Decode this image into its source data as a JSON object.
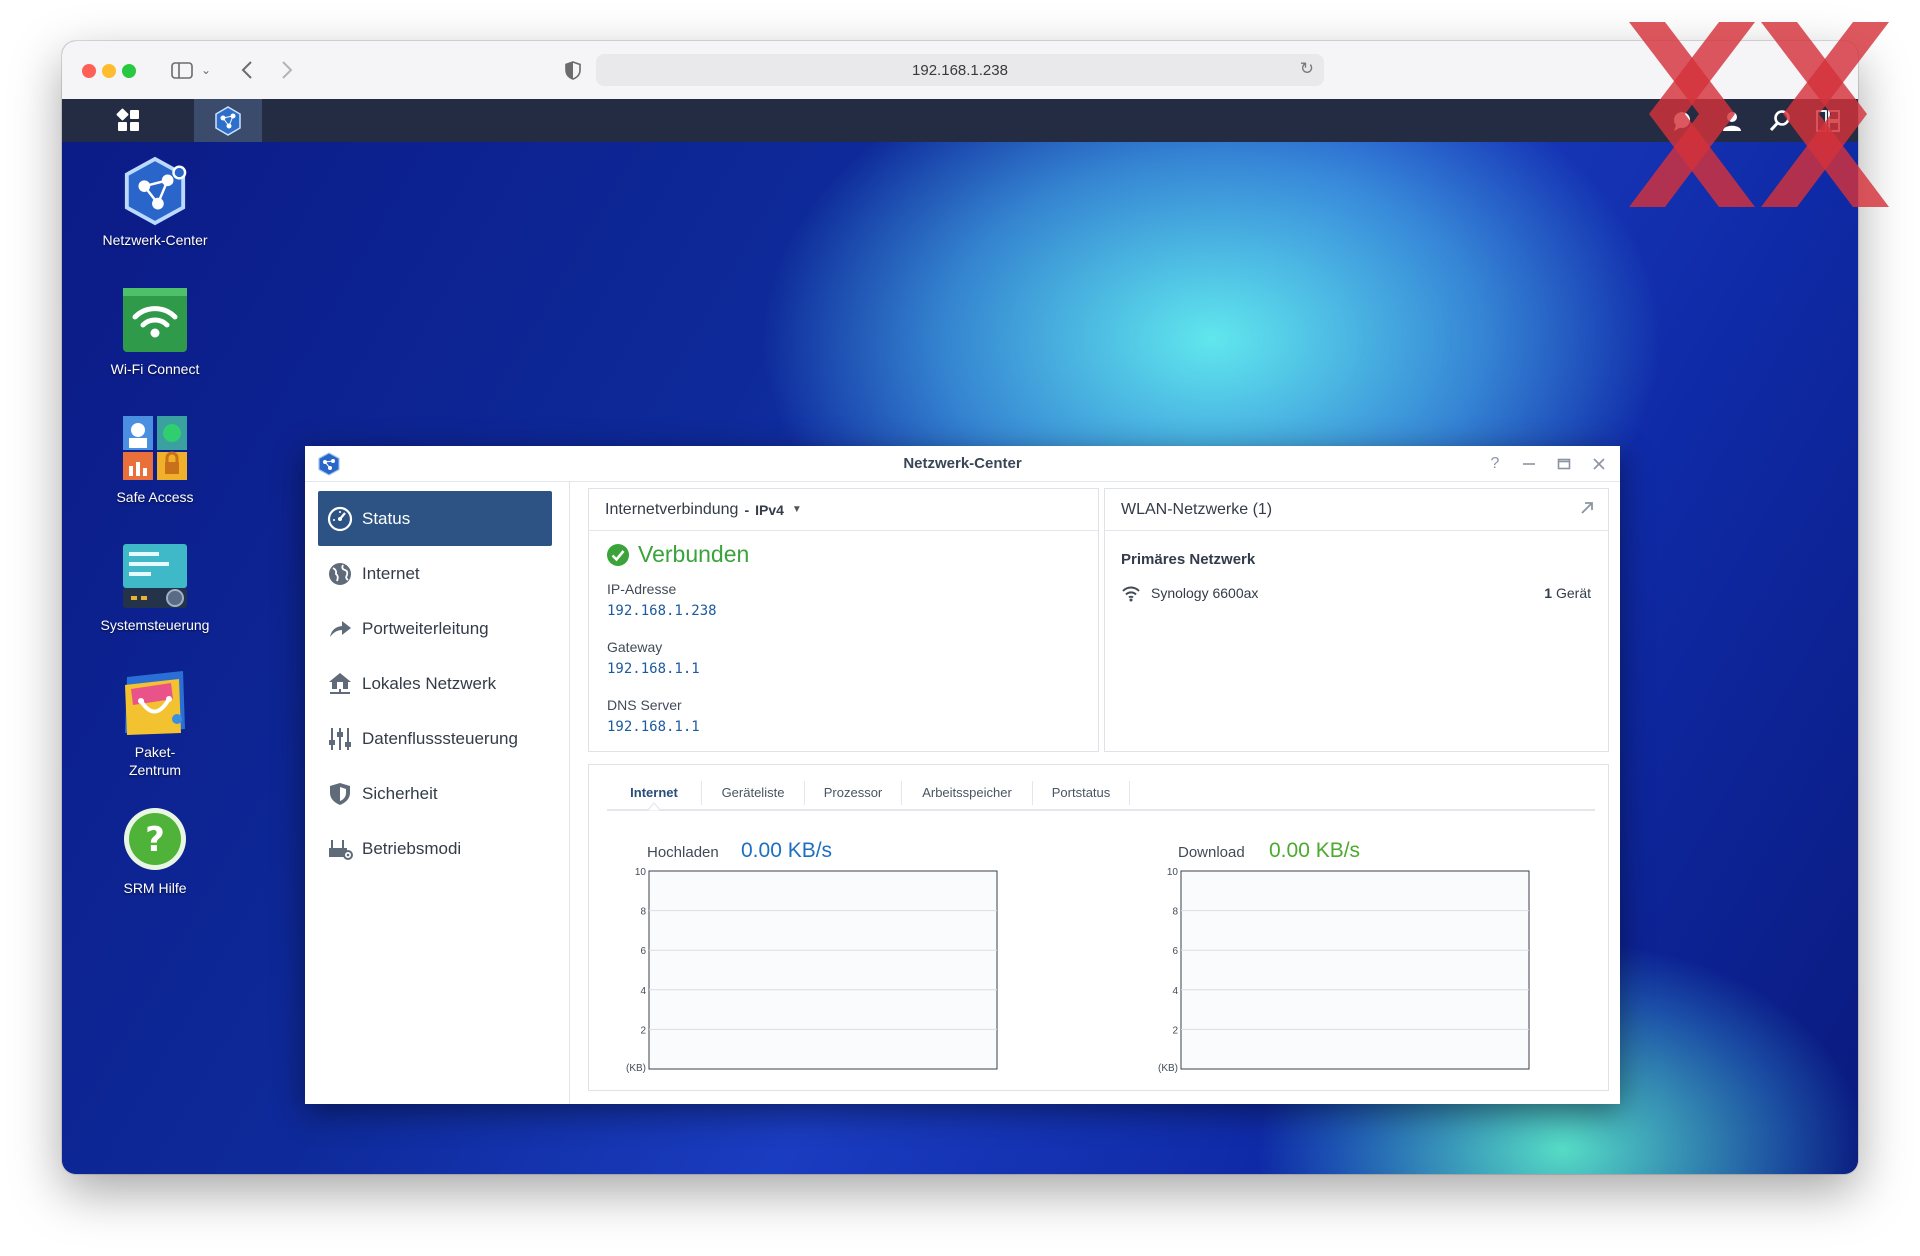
{
  "browser": {
    "address": "192.168.1.238"
  },
  "desktop_icons": [
    {
      "label": "Netzwerk-Center",
      "icon": "network-center-icon"
    },
    {
      "label": "Wi-Fi Connect",
      "icon": "wifi-connect-icon"
    },
    {
      "label": "Safe Access",
      "icon": "safe-access-icon"
    },
    {
      "label": "Systemsteuerung",
      "icon": "control-panel-icon"
    },
    {
      "label": "Paket-\nZentrum",
      "icon": "package-center-icon"
    },
    {
      "label": "SRM Hilfe",
      "icon": "help-icon"
    }
  ],
  "window": {
    "title": "Netzwerk-Center",
    "controls": [
      "help-icon",
      "minimize-icon",
      "maximize-icon",
      "close-icon"
    ]
  },
  "sidebar": {
    "items": [
      {
        "label": "Status",
        "icon": "gauge-icon",
        "active": true
      },
      {
        "label": "Internet",
        "icon": "globe-icon",
        "active": false
      },
      {
        "label": "Portweiterleitung",
        "icon": "arrow-forward-icon",
        "active": false
      },
      {
        "label": "Lokales Netzwerk",
        "icon": "home-network-icon",
        "active": false
      },
      {
        "label": "Datenflusssteuerung",
        "icon": "sliders-icon",
        "active": false
      },
      {
        "label": "Sicherheit",
        "icon": "shield-icon",
        "active": false
      },
      {
        "label": "Betriebsmodi",
        "icon": "router-icon",
        "active": false
      }
    ]
  },
  "internet_panel": {
    "title": "Internetverbindung",
    "protocol": "IPv4",
    "status": "Verbunden",
    "ip_label": "IP-Adresse",
    "ip_value": "192.168.1.238",
    "gateway_label": "Gateway",
    "gateway_value": "192.168.1.1",
    "dns_label": "DNS Server",
    "dns_value": "192.168.1.1"
  },
  "wlan_panel": {
    "title": "WLAN-Netzwerke (1)",
    "network_title": "Primäres Netzwerk",
    "ssid": "Synology 6600ax",
    "device_count": "1",
    "device_unit": "Gerät"
  },
  "traffic_panel": {
    "tabs": [
      "Internet",
      "Geräteliste",
      "Prozessor",
      "Arbeitsspeicher",
      "Portstatus"
    ],
    "active_tab": 0,
    "upload_label": "Hochladen",
    "upload_value": "0.00 KB/s",
    "download_label": "Download",
    "download_value": "0.00 KB/s"
  },
  "colors": {
    "accent": "#2c5384",
    "upload": "#1f6fc1",
    "download": "#4caa2f",
    "connected": "#3aa33a"
  },
  "chart_data": [
    {
      "type": "line",
      "series": [],
      "ylabel": "(KB)",
      "ylim": [
        0,
        10
      ],
      "yticks": [
        10,
        8,
        6,
        4,
        2
      ],
      "grid": true
    },
    {
      "type": "line",
      "series": [],
      "ylabel": "(KB)",
      "ylim": [
        0,
        10
      ],
      "yticks": [
        10,
        8,
        6,
        4,
        2
      ],
      "grid": true
    }
  ]
}
